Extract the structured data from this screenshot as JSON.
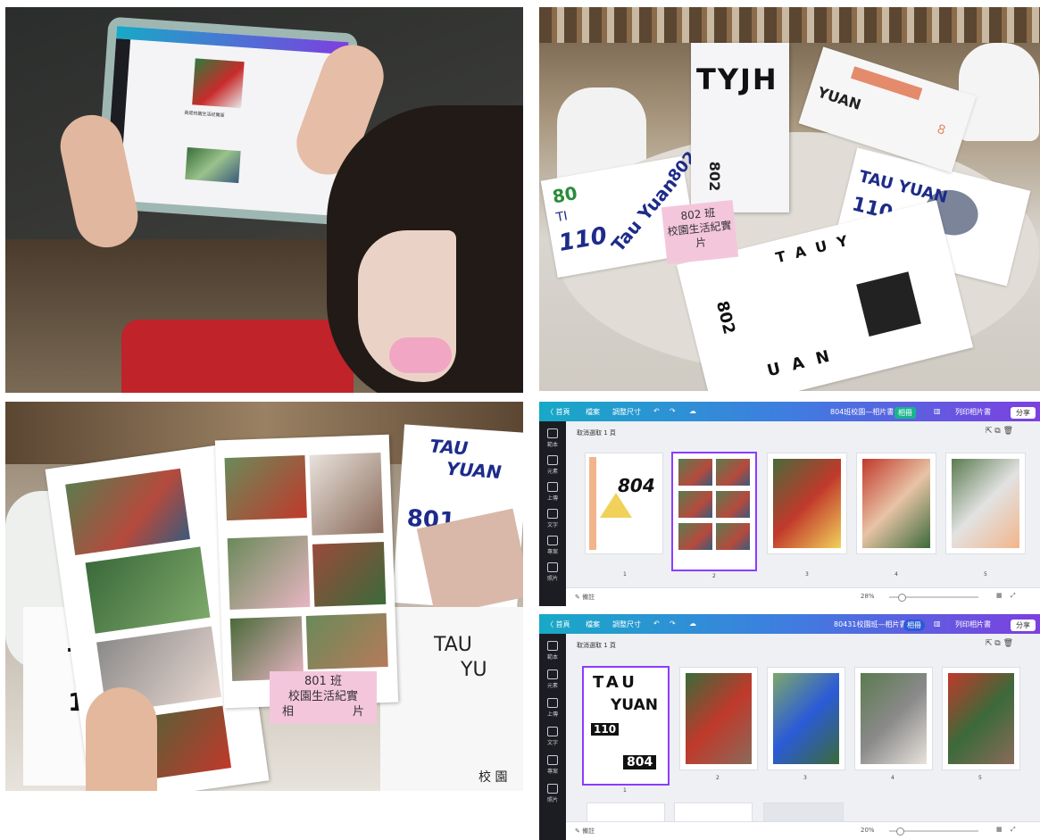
{
  "photo1": {
    "tablet_text": "我是校園生活紀實版"
  },
  "photo2": {
    "card_title": "TYJH",
    "card_number": "802",
    "sign_line1": "802 班",
    "sign_line2": "校園生活紀實",
    "sign_line3": "片",
    "paper_texts": [
      "80",
      "TI",
      "110",
      "Tau Yuan",
      "802",
      "TAU YUAN",
      "110 802",
      "T",
      "A",
      "U",
      "Y",
      "U",
      "A",
      "N",
      "802",
      "YUAN",
      "8"
    ]
  },
  "photo3": {
    "sign_line1": "801 班",
    "sign_line2": "校園生活紀實",
    "sign_line3_left": "相",
    "sign_line3_right": "片",
    "paper_texts": [
      "TAU",
      "YUAN",
      "801",
      "T",
      "1",
      "TAU",
      "YU",
      "校 園"
    ]
  },
  "canva1": {
    "back": "〈 首頁",
    "file": "檔案",
    "resize": "調整尺寸",
    "title": "804班校園—相片書",
    "share": "分享",
    "print": "列印相片書",
    "page_label": "取消選取 1 頁",
    "notes": "備註",
    "zoom": "28%",
    "cover_number": "804",
    "page_numbers": [
      "1",
      "2",
      "3",
      "4",
      "5"
    ]
  },
  "canva2": {
    "back": "〈 首頁",
    "file": "檔案",
    "resize": "調整尺寸",
    "title": "80431校園班—相片書",
    "share": "分享",
    "print": "列印相片書",
    "page_label": "取消選取 1 頁",
    "notes": "備註",
    "zoom": "20%",
    "cover_line1": "TAU",
    "cover_line2": "YUAN",
    "cover_number": "110",
    "cover_class": "804",
    "page_numbers": [
      "1",
      "2",
      "3",
      "4",
      "5"
    ]
  },
  "sidebar_items": [
    "範本",
    "元素",
    "上傳",
    "文字",
    "專案",
    "照片"
  ],
  "colors": {
    "canva_gradient_start": "#18a9c7",
    "canva_gradient_end": "#7d3fe0",
    "selection": "#8b3dff",
    "sign_pink": "#f4c6dc"
  }
}
